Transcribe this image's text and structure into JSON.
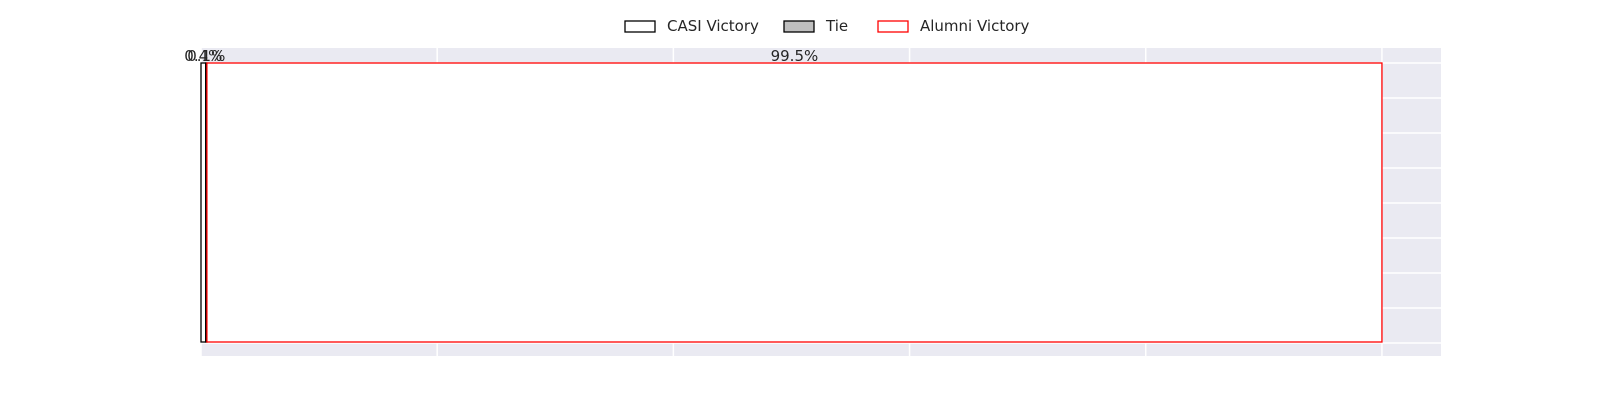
{
  "chart_data": {
    "type": "bar",
    "orientation": "horizontal",
    "stacked": true,
    "xlim": [
      0,
      105
    ],
    "grid": true,
    "legend_position": "top-center",
    "series": [
      {
        "name": "CASI Victory",
        "value": 0.4,
        "label": "0.4%",
        "fill": "#ffffff",
        "stroke": "#000000"
      },
      {
        "name": "Tie",
        "value": 0.1,
        "label": "0.1%",
        "fill": "#bfbfbf",
        "stroke": "#000000"
      },
      {
        "name": "Alumni Victory",
        "value": 99.5,
        "label": "99.5%",
        "fill": "#ffffff",
        "stroke": "#ff0000"
      }
    ],
    "colors": {
      "plot_background": "#eaeaf2",
      "grid": "#ffffff",
      "text": "#262626"
    }
  }
}
